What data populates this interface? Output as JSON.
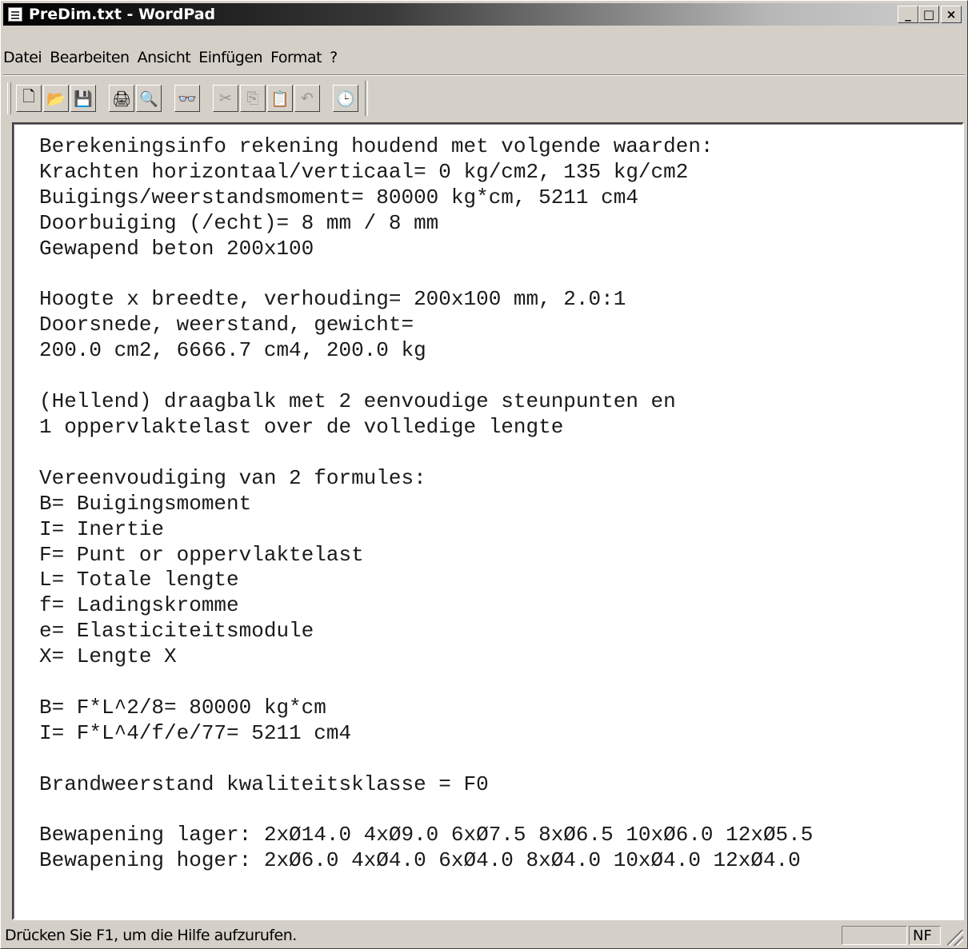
{
  "window": {
    "title": "PreDim.txt - WordPad",
    "minimize_label": "_",
    "maximize_label": "□",
    "close_label": "×"
  },
  "menu": {
    "items": [
      "Datei",
      "Bearbeiten",
      "Ansicht",
      "Einfügen",
      "Format",
      "?"
    ]
  },
  "toolbar": {
    "new": "🗋",
    "open": "📂",
    "save": "💾",
    "print": "🖨",
    "preview": "🔍",
    "find": "👓",
    "cut": "✂",
    "copy": "⎘",
    "paste": "📋",
    "undo": "↶",
    "datetime": "🕒"
  },
  "document": {
    "lines": [
      "Berekeningsinfo rekening houdend met volgende waarden:",
      "Krachten horizontaal/verticaal= 0 kg/cm2, 135 kg/cm2",
      "Buigings/weerstandsmoment= 80000 kg*cm, 5211 cm4",
      "Doorbuiging (/echt)= 8 mm / 8 mm",
      "Gewapend beton 200x100",
      "",
      "Hoogte x breedte, verhouding= 200x100 mm, 2.0:1",
      "Doorsnede, weerstand, gewicht=",
      "200.0 cm2, 6666.7 cm4, 200.0 kg",
      "",
      "(Hellend) draagbalk met 2 eenvoudige steunpunten en",
      "1 oppervlaktelast over de volledige lengte",
      "",
      "Vereenvoudiging van 2 formules:",
      "B= Buigingsmoment",
      "I= Inertie",
      "F= Punt or oppervlaktelast",
      "L= Totale lengte",
      "f= Ladingskromme",
      "e= Elasticiteitsmodule",
      "X= Lengte X",
      "",
      "B= F*L^2/8= 80000 kg*cm",
      "I= F*L^4/f/e/77= 5211 cm4",
      "",
      "Brandweerstand kwaliteitsklasse = F0",
      "",
      "Bewapening lager: 2xØ14.0 4xØ9.0 6xØ7.5 8xØ6.5 10xØ6.0 12xØ5.5",
      "Bewapening hoger: 2xØ6.0 4xØ4.0 6xØ4.0 8xØ4.0 10xØ4.0 12xØ4.0"
    ]
  },
  "statusbar": {
    "help_text": "Drücken Sie F1, um die Hilfe aufzurufen.",
    "panel_empty": "",
    "numlock": "NF"
  }
}
